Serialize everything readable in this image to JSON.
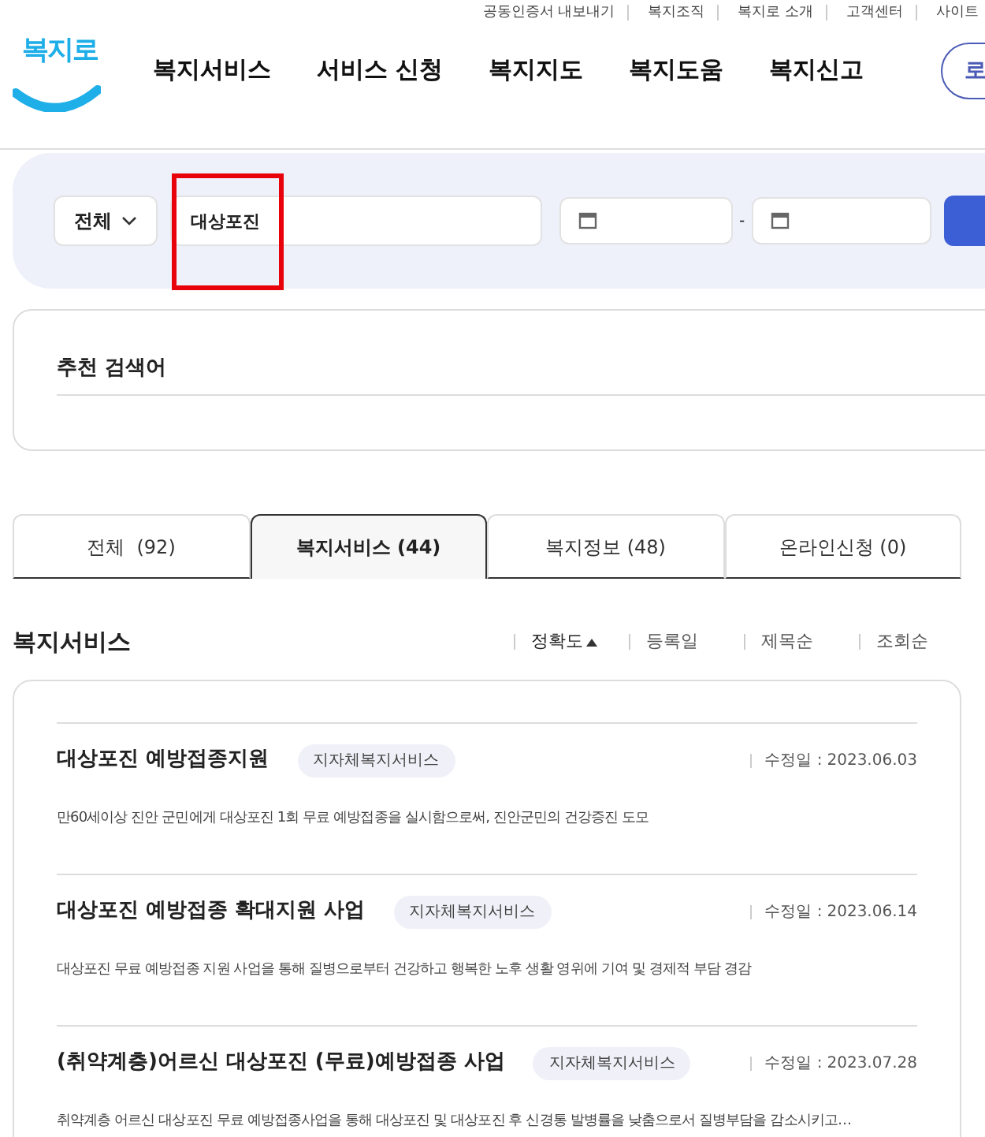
{
  "utility_links": [
    "공동인증서 내보내기",
    "복지조직",
    "복지로 소개",
    "고객센터",
    "사이트"
  ],
  "logo": {
    "text": "복지로"
  },
  "nav": [
    "복지서비스",
    "서비스 신청",
    "복지지도",
    "복지도움",
    "복지신고"
  ],
  "login_button": "로",
  "search": {
    "scope": "전체",
    "query": "대상포진",
    "highlighted": true,
    "date_separator": "-"
  },
  "recommend": {
    "title": "추천 검색어"
  },
  "tabs": [
    {
      "label": "전체  (92)",
      "selected": false
    },
    {
      "label": "복지서비스 (44)",
      "selected": true
    },
    {
      "label": "복지정보 (48)",
      "selected": false
    },
    {
      "label": "온라인신청 (0)",
      "selected": false
    }
  ],
  "section_title": "복지서비스",
  "sort_options": [
    {
      "label": "정확도",
      "selected": true
    },
    {
      "label": "등록일",
      "selected": false
    },
    {
      "label": "제목순",
      "selected": false
    },
    {
      "label": "조회순",
      "selected": false
    }
  ],
  "results": [
    {
      "title": "대상포진 예방접종지원",
      "tag": "지자체복지서비스",
      "date_label": "수정일 :",
      "date": "2023.06.03",
      "description": "만60세이상 진안 군민에게 대상포진 1회 무료 예방접종을 실시함으로써, 진안군민의 건강증진 도모"
    },
    {
      "title": "대상포진 예방접종 확대지원 사업",
      "tag": "지자체복지서비스",
      "date_label": "수정일 :",
      "date": "2023.06.14",
      "description": "대상포진 무료 예방접종 지원 사업을 통해 질병으로부터 건강하고 행복한 노후 생활 영위에 기여 및 경제적 부담 경감"
    },
    {
      "title": "(취약계층)어르신 대상포진 (무료)예방접종 사업",
      "tag": "지자체복지서비스",
      "date_label": "수정일 :",
      "date": "2023.07.28",
      "description": "취약계층 어르신 대상포진 무료 예방접종사업을 통해 대상포진 및 대상포진 후 신경통 발병률을 낮춤으로서 질병부담을 감소시키고…"
    }
  ]
}
